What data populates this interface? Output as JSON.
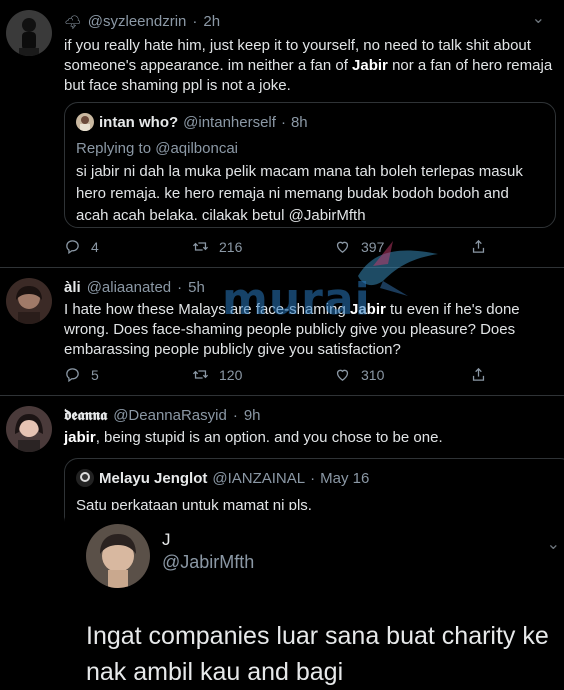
{
  "tweets": [
    {
      "emoji": "🌩",
      "handle": "@syzleendzrin",
      "sep": "·",
      "time": "2h",
      "text_parts": [
        "if you really hate him, just keep it to yourself, no need to talk shit about someone's appearance. im neither a fan of ",
        "Jabir",
        " nor a fan of hero remaja but face shaming ppl is not a joke."
      ],
      "quote": {
        "name": "intan who?",
        "handle": "@intanherself",
        "sep": "·",
        "time": "8h",
        "replying_prefix": "Replying to",
        "replying_handle": "@aqilboncai",
        "text": "si jabir ni dah la muka pelik macam mana tah boleh terlepas masuk hero remaja. ke hero remaja ni memang budak bodoh bodoh and acah acah belaka. cilakak betul @JabirMfth"
      },
      "actions": {
        "replies": "4",
        "retweets": "216",
        "likes": "397"
      }
    },
    {
      "name": "àli",
      "handle": "@aliaanated",
      "sep": "·",
      "time": "5h",
      "text_parts": [
        "I hate how these Malays are face-shaming ",
        "Jabir",
        " tu even if he's done wrong. Does face-shaming people publicly give you pleasure? Does embarassing people publicly give you satisfaction?"
      ],
      "actions": {
        "replies": "5",
        "retweets": "120",
        "likes": "310"
      }
    },
    {
      "name": "𝖉𝖊𝖆𝖓𝖓𝖆",
      "handle": "@DeannaRasyid",
      "sep": "·",
      "time": "9h",
      "text_parts": [
        "jabir",
        ", being stupid is an option. and you chose to be one."
      ],
      "quote": {
        "name": "Melayu Jenglot",
        "handle": "@IANZAINAL",
        "sep": "·",
        "time": "May 16",
        "text": "Satu perkataan untuk mamat ni pls."
      },
      "embed": {
        "name": "J",
        "handle": "@JabirMfth",
        "text": "Ingat companies luar sana buat charity ke nak ambil kau and bagi"
      }
    }
  ],
  "watermark": "murai",
  "icons": {
    "reply": "reply-icon",
    "retweet": "retweet-icon",
    "like": "heart-icon",
    "share": "share-icon",
    "more": "more-icon",
    "chevron": "chevron-down-icon"
  },
  "colors": {
    "background": "#000000",
    "text": "#e1e4e6",
    "muted": "#8b98a5",
    "border": "#2f3336",
    "watermark": "#2878be"
  }
}
